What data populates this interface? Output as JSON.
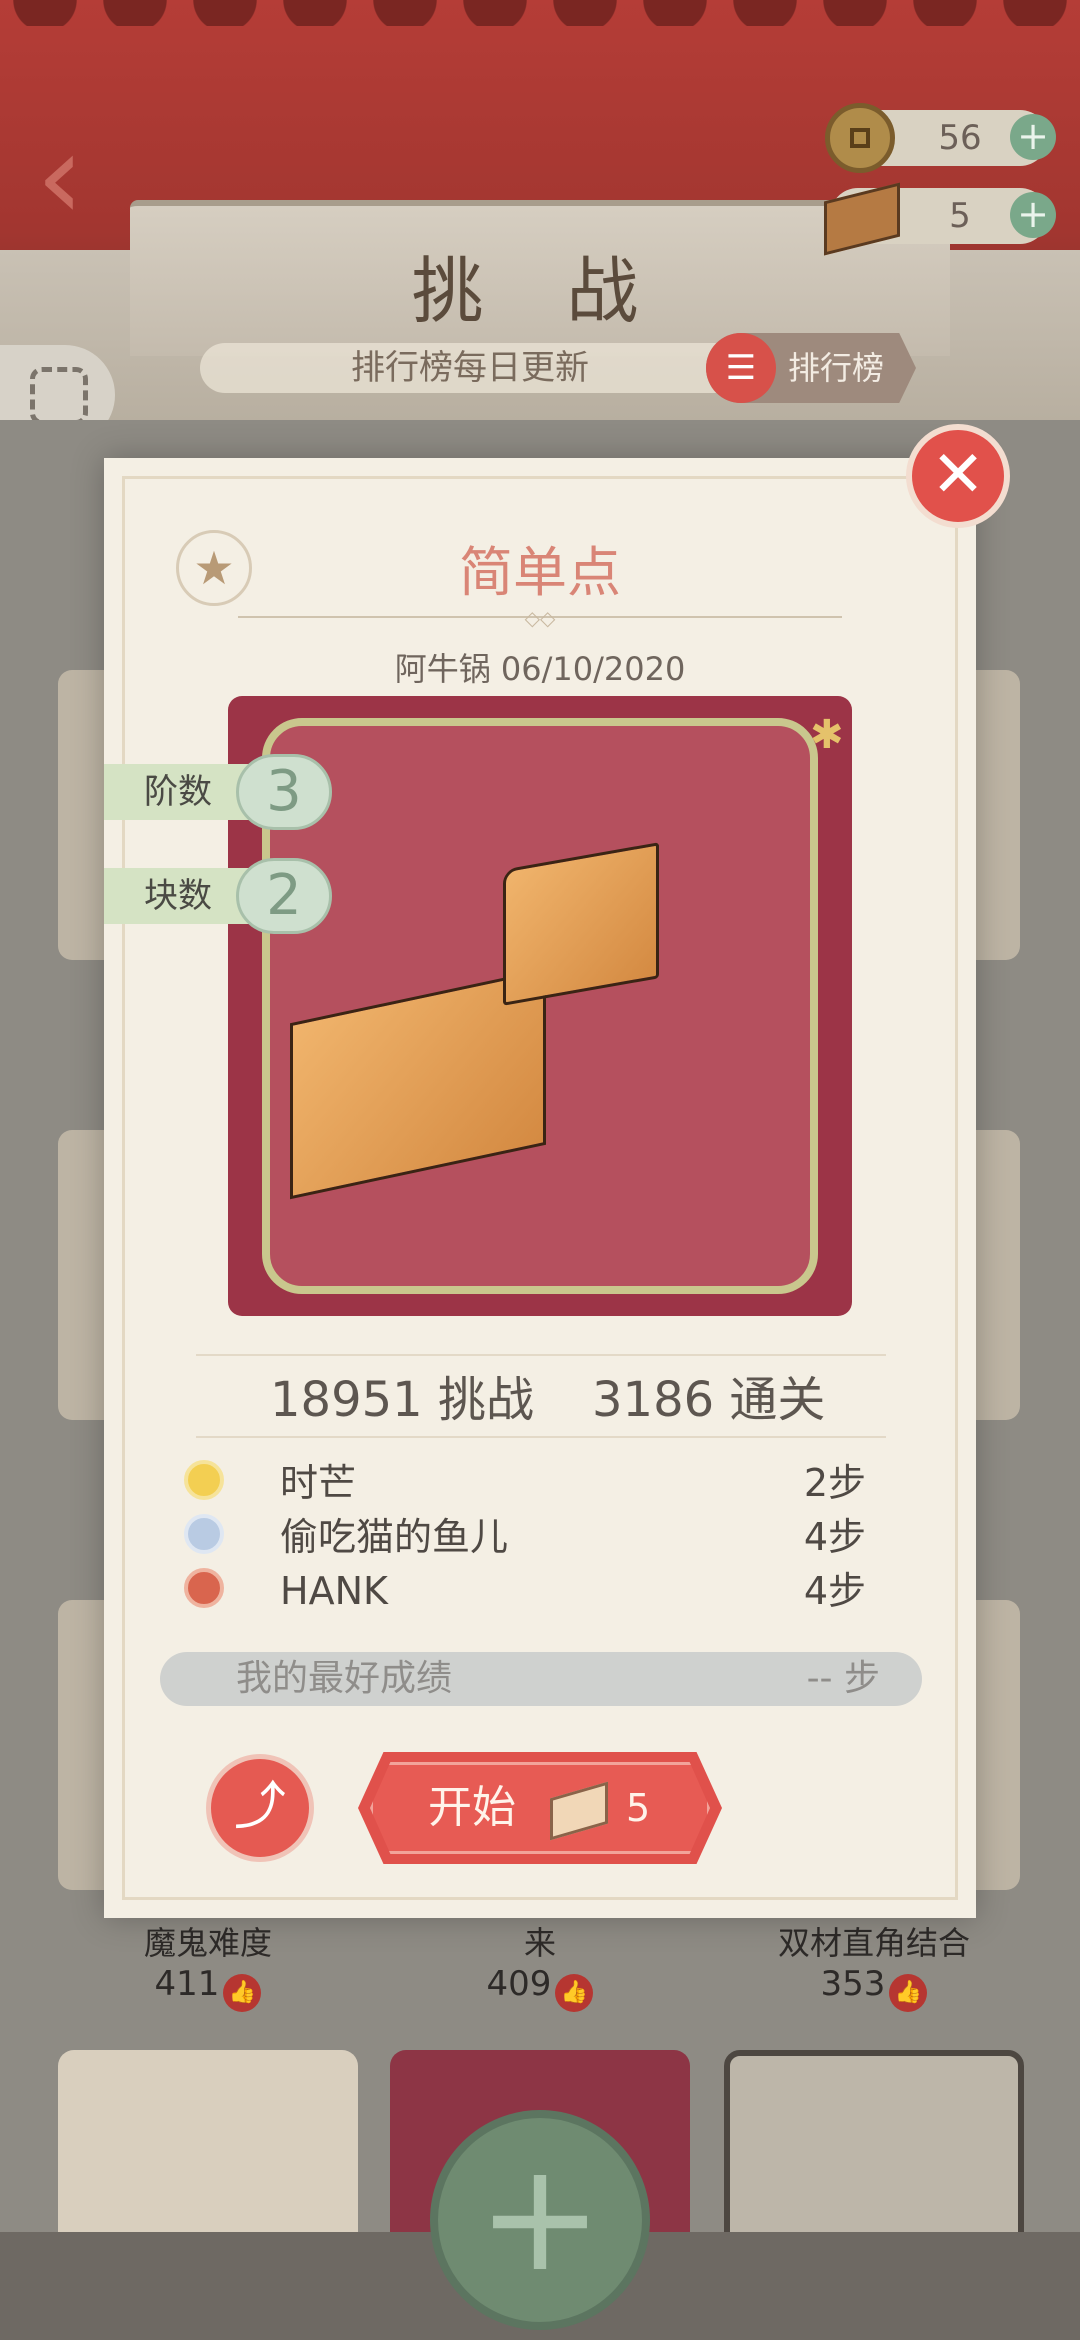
{
  "header": {
    "title": "挑 战",
    "subtitle": "排行榜每日更新",
    "rank_button": "排行榜"
  },
  "currency": {
    "coins": "56",
    "blocks": "5"
  },
  "background": {
    "cards": [
      {
        "label": "魔鬼难度",
        "likes": "411"
      },
      {
        "label": "来",
        "likes": "409"
      },
      {
        "label": "双材直角结合",
        "likes": "353"
      }
    ]
  },
  "modal": {
    "name": "简单点",
    "author_date": "阿牛锅 06/10/2020",
    "badges": [
      {
        "label": "阶数",
        "value": "3"
      },
      {
        "label": "块数",
        "value": "2"
      }
    ],
    "challenges": "18951 挑战",
    "clears": "3186 通关",
    "leaderboard": [
      {
        "name": "时芒",
        "steps": "2步",
        "medal": "gold"
      },
      {
        "name": "偷吃猫的鱼儿",
        "steps": "4步",
        "medal": "silver"
      },
      {
        "name": "HANK",
        "steps": "4步",
        "medal": "bronze"
      }
    ],
    "best_label": "我的最好成绩",
    "best_value": "-- 步",
    "start_label": "开始",
    "start_cost": "5"
  },
  "colors": {
    "accent_red": "#e0514b",
    "banner_red": "#a23630",
    "modal_bg": "#f4efe4",
    "puzzle_bg": "#9c3447",
    "green": "#7aa88a"
  },
  "icons": [
    "back-arrow-icon",
    "coin-icon",
    "block-icon",
    "plus-icon",
    "scan-icon",
    "list-icon",
    "close-icon",
    "star-icon",
    "share-icon",
    "thumb-up-icon",
    "add-icon",
    "medal-gold-icon",
    "medal-silver-icon",
    "medal-bronze-icon"
  ]
}
